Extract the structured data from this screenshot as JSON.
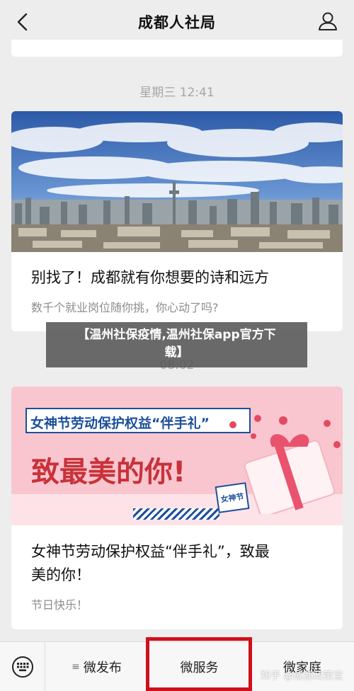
{
  "header": {
    "title": "成都人社局"
  },
  "messages": [
    {
      "time": "星期三 12:41",
      "title": "别找了！成都就有你想要的诗和远方",
      "desc": "数千个就业岗位随你挑，你心动了吗?"
    },
    {
      "time": "08:02",
      "title_line1": "女神节劳动保护权益“伴手礼”，致最",
      "title_line2": "美的你！",
      "desc": "节日快乐！",
      "banner": {
        "heading": "女神节劳动保护权益“伴手礼”",
        "big_text": "致最美的你!",
        "tag": "女神节"
      }
    }
  ],
  "overlay": {
    "line1": "【温州社保疫情,温州社保app官方下",
    "line2": "载】"
  },
  "tabbar": {
    "tab1": "微发布",
    "tab2": "微服务",
    "tab3": "微家庭"
  },
  "watermark": "知乎 @成都政策宝",
  "colors": {
    "highlight": "#d0101b",
    "banner_pink": "#f9c6cf",
    "banner_blue": "#1d4f9c"
  }
}
